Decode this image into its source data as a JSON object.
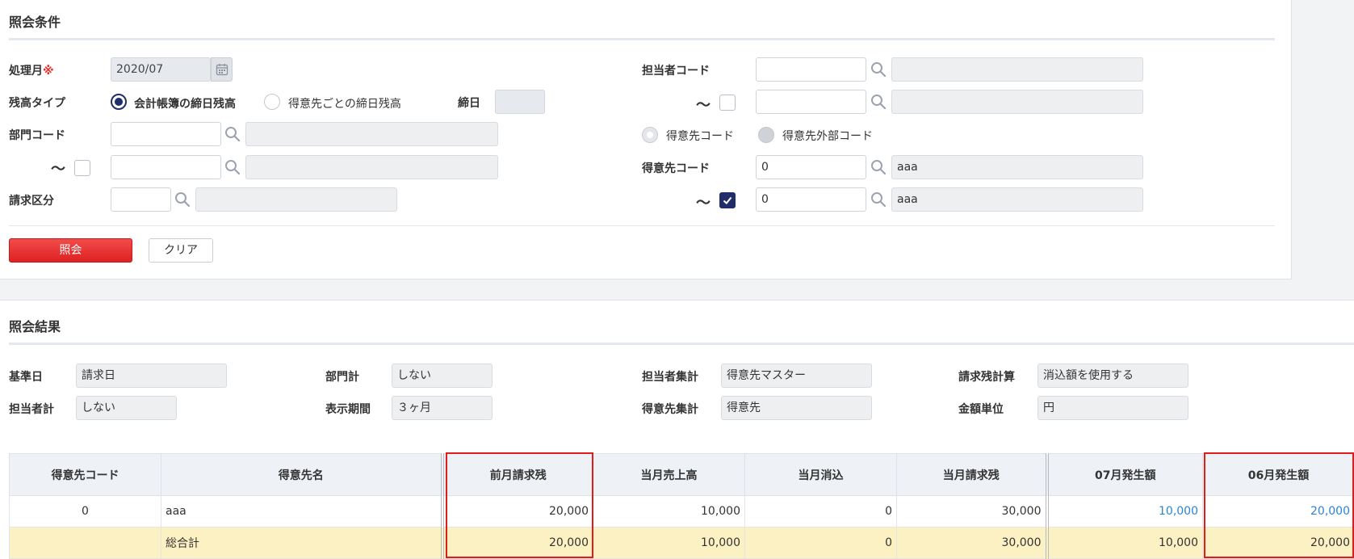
{
  "query": {
    "title": "照会条件",
    "month_label": "処理月",
    "required_mark": "※",
    "month_value": "2020/07",
    "balance_type_label": "残高タイプ",
    "balance_type_opt1": "会計帳簿の締日残高",
    "balance_type_opt2": "得意先ごとの締日残高",
    "closing_day_label": "締日",
    "closing_day_value": "",
    "dept_code_label": "部門コード",
    "tilde": "～",
    "billing_div_label": "請求区分",
    "staff_code_label": "担当者コード",
    "customer_code_type_opt1": "得意先コード",
    "customer_code_type_opt2": "得意先外部コード",
    "customer_code_label": "得意先コード",
    "customer_from_code": "0",
    "customer_from_name": "aaa",
    "customer_to_code": "0",
    "customer_to_name": "aaa",
    "search_button": "照会",
    "clear_button": "クリア"
  },
  "results": {
    "title": "照会結果",
    "base_date_label": "基準日",
    "base_date_value": "請求日",
    "dept_total_label": "部門計",
    "dept_total_value": "しない",
    "staff_agg_label": "担当者集計",
    "staff_agg_value": "得意先マスター",
    "balance_calc_label": "請求残計算",
    "balance_calc_value": "消込額を使用する",
    "staff_total_label": "担当者計",
    "staff_total_value": "しない",
    "period_label": "表示期間",
    "period_value": "３ヶ月",
    "customer_agg_label": "得意先集計",
    "customer_agg_value": "得意先",
    "unit_label": "金額単位",
    "unit_value": "円"
  },
  "table": {
    "headers": [
      "得意先コード",
      "得意先名",
      "前月請求残",
      "当月売上高",
      "当月消込",
      "当月請求残",
      "07月発生額",
      "06月発生額"
    ],
    "rows": [
      {
        "code": "0",
        "name": "aaa",
        "prev_balance": "20,000",
        "sales": "10,000",
        "cleared": "0",
        "balance": "30,000",
        "m07": "10,000",
        "m06": "20,000"
      }
    ],
    "total": {
      "code": "",
      "name": "総合計",
      "prev_balance": "20,000",
      "sales": "10,000",
      "cleared": "0",
      "balance": "30,000",
      "m07": "10,000",
      "m06": "20,000"
    }
  },
  "colors": {
    "accent": "#1f2d6b",
    "primary_button": "#e43131",
    "highlight": "#e21b1b",
    "link": "#2b84d6",
    "total_row": "#fcf1c2"
  }
}
